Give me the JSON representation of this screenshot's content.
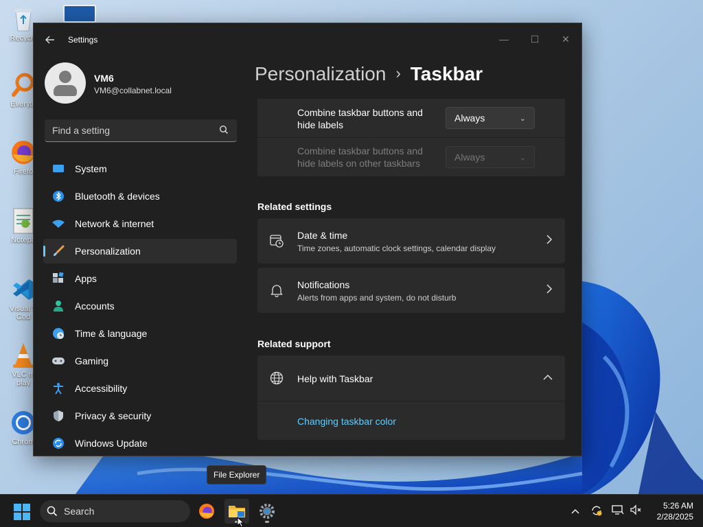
{
  "desktop": {
    "icons": [
      {
        "name": "recycle-bin",
        "label": "Recycle"
      },
      {
        "name": "everything",
        "label": "Everyth"
      },
      {
        "name": "firefox",
        "label": "Firefo"
      },
      {
        "name": "notepad",
        "label": "Notepa"
      },
      {
        "name": "visual-studio-code",
        "label": "Visual S\nCod"
      },
      {
        "name": "vlc",
        "label": "VLC m\nplay"
      },
      {
        "name": "chrome",
        "label": "Chrom"
      }
    ]
  },
  "window": {
    "title": "Settings",
    "controls": {
      "minimize": "—",
      "maximize": "☐",
      "close": "✕"
    }
  },
  "user": {
    "name": "VM6",
    "email": "VM6@collabnet.local"
  },
  "search": {
    "placeholder": "Find a setting"
  },
  "nav": {
    "items": [
      {
        "label": "System",
        "icon": "system-icon",
        "active": false
      },
      {
        "label": "Bluetooth & devices",
        "icon": "bluetooth-icon",
        "active": false
      },
      {
        "label": "Network & internet",
        "icon": "wifi-icon",
        "active": false
      },
      {
        "label": "Personalization",
        "icon": "brush-icon",
        "active": true
      },
      {
        "label": "Apps",
        "icon": "apps-icon",
        "active": false
      },
      {
        "label": "Accounts",
        "icon": "accounts-icon",
        "active": false
      },
      {
        "label": "Time & language",
        "icon": "globe-clock-icon",
        "active": false
      },
      {
        "label": "Gaming",
        "icon": "gamepad-icon",
        "active": false
      },
      {
        "label": "Accessibility",
        "icon": "accessibility-icon",
        "active": false
      },
      {
        "label": "Privacy & security",
        "icon": "shield-icon",
        "active": false
      },
      {
        "label": "Windows Update",
        "icon": "update-icon",
        "active": false
      }
    ]
  },
  "breadcrumb": {
    "parent": "Personalization",
    "separator": "›",
    "current": "Taskbar"
  },
  "combine": {
    "main_label": "Combine taskbar buttons and hide labels",
    "main_value": "Always",
    "other_label": "Combine taskbar buttons and hide labels on other taskbars",
    "other_value": "Always"
  },
  "related_settings": {
    "heading": "Related settings",
    "items": [
      {
        "title": "Date & time",
        "subtitle": "Time zones, automatic clock settings, calendar display",
        "icon": "date-time-icon"
      },
      {
        "title": "Notifications",
        "subtitle": "Alerts from apps and system, do not disturb",
        "icon": "bell-icon"
      }
    ]
  },
  "related_support": {
    "heading": "Related support",
    "help_title": "Help with Taskbar",
    "link": "Changing taskbar color"
  },
  "tooltip": "File Explorer",
  "taskbar": {
    "search_label": "Search",
    "time": "5:26 AM",
    "date": "2/28/2025"
  },
  "colors": {
    "accent": "#60cdff",
    "window_bg": "#202020",
    "card_bg": "#2b2b2b",
    "taskbar_bg": "#1c1c1c"
  }
}
